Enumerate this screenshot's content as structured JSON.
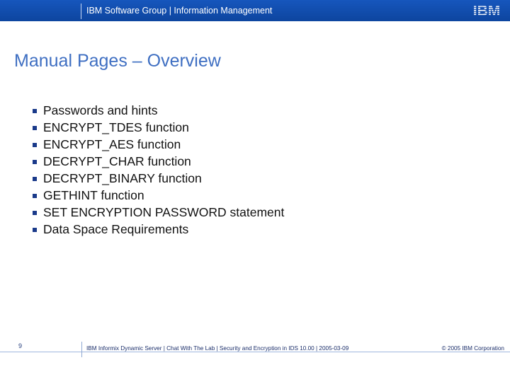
{
  "header": {
    "title": "IBM Software Group | Information Management",
    "logo_text": "IBM"
  },
  "slide": {
    "title": "Manual Pages – Overview",
    "bullets": [
      "Passwords and hints",
      "ENCRYPT_TDES function",
      "ENCRYPT_AES function",
      "DECRYPT_CHAR function",
      "DECRYPT_BINARY function",
      "GETHINT function",
      "SET ENCRYPTION PASSWORD statement",
      "Data Space Requirements"
    ]
  },
  "footer": {
    "page_number": "9",
    "text": "IBM Informix Dynamic Server  |  Chat With The Lab | Security and Encryption in IDS 10.00 | 2005-03-09",
    "copyright": "© 2005 IBM Corporation"
  },
  "colors": {
    "header_band": "#1656bd",
    "title": "#3f6fc2",
    "bullet_marker": "#1a3a8a",
    "footer_text": "#1b2e6a"
  }
}
